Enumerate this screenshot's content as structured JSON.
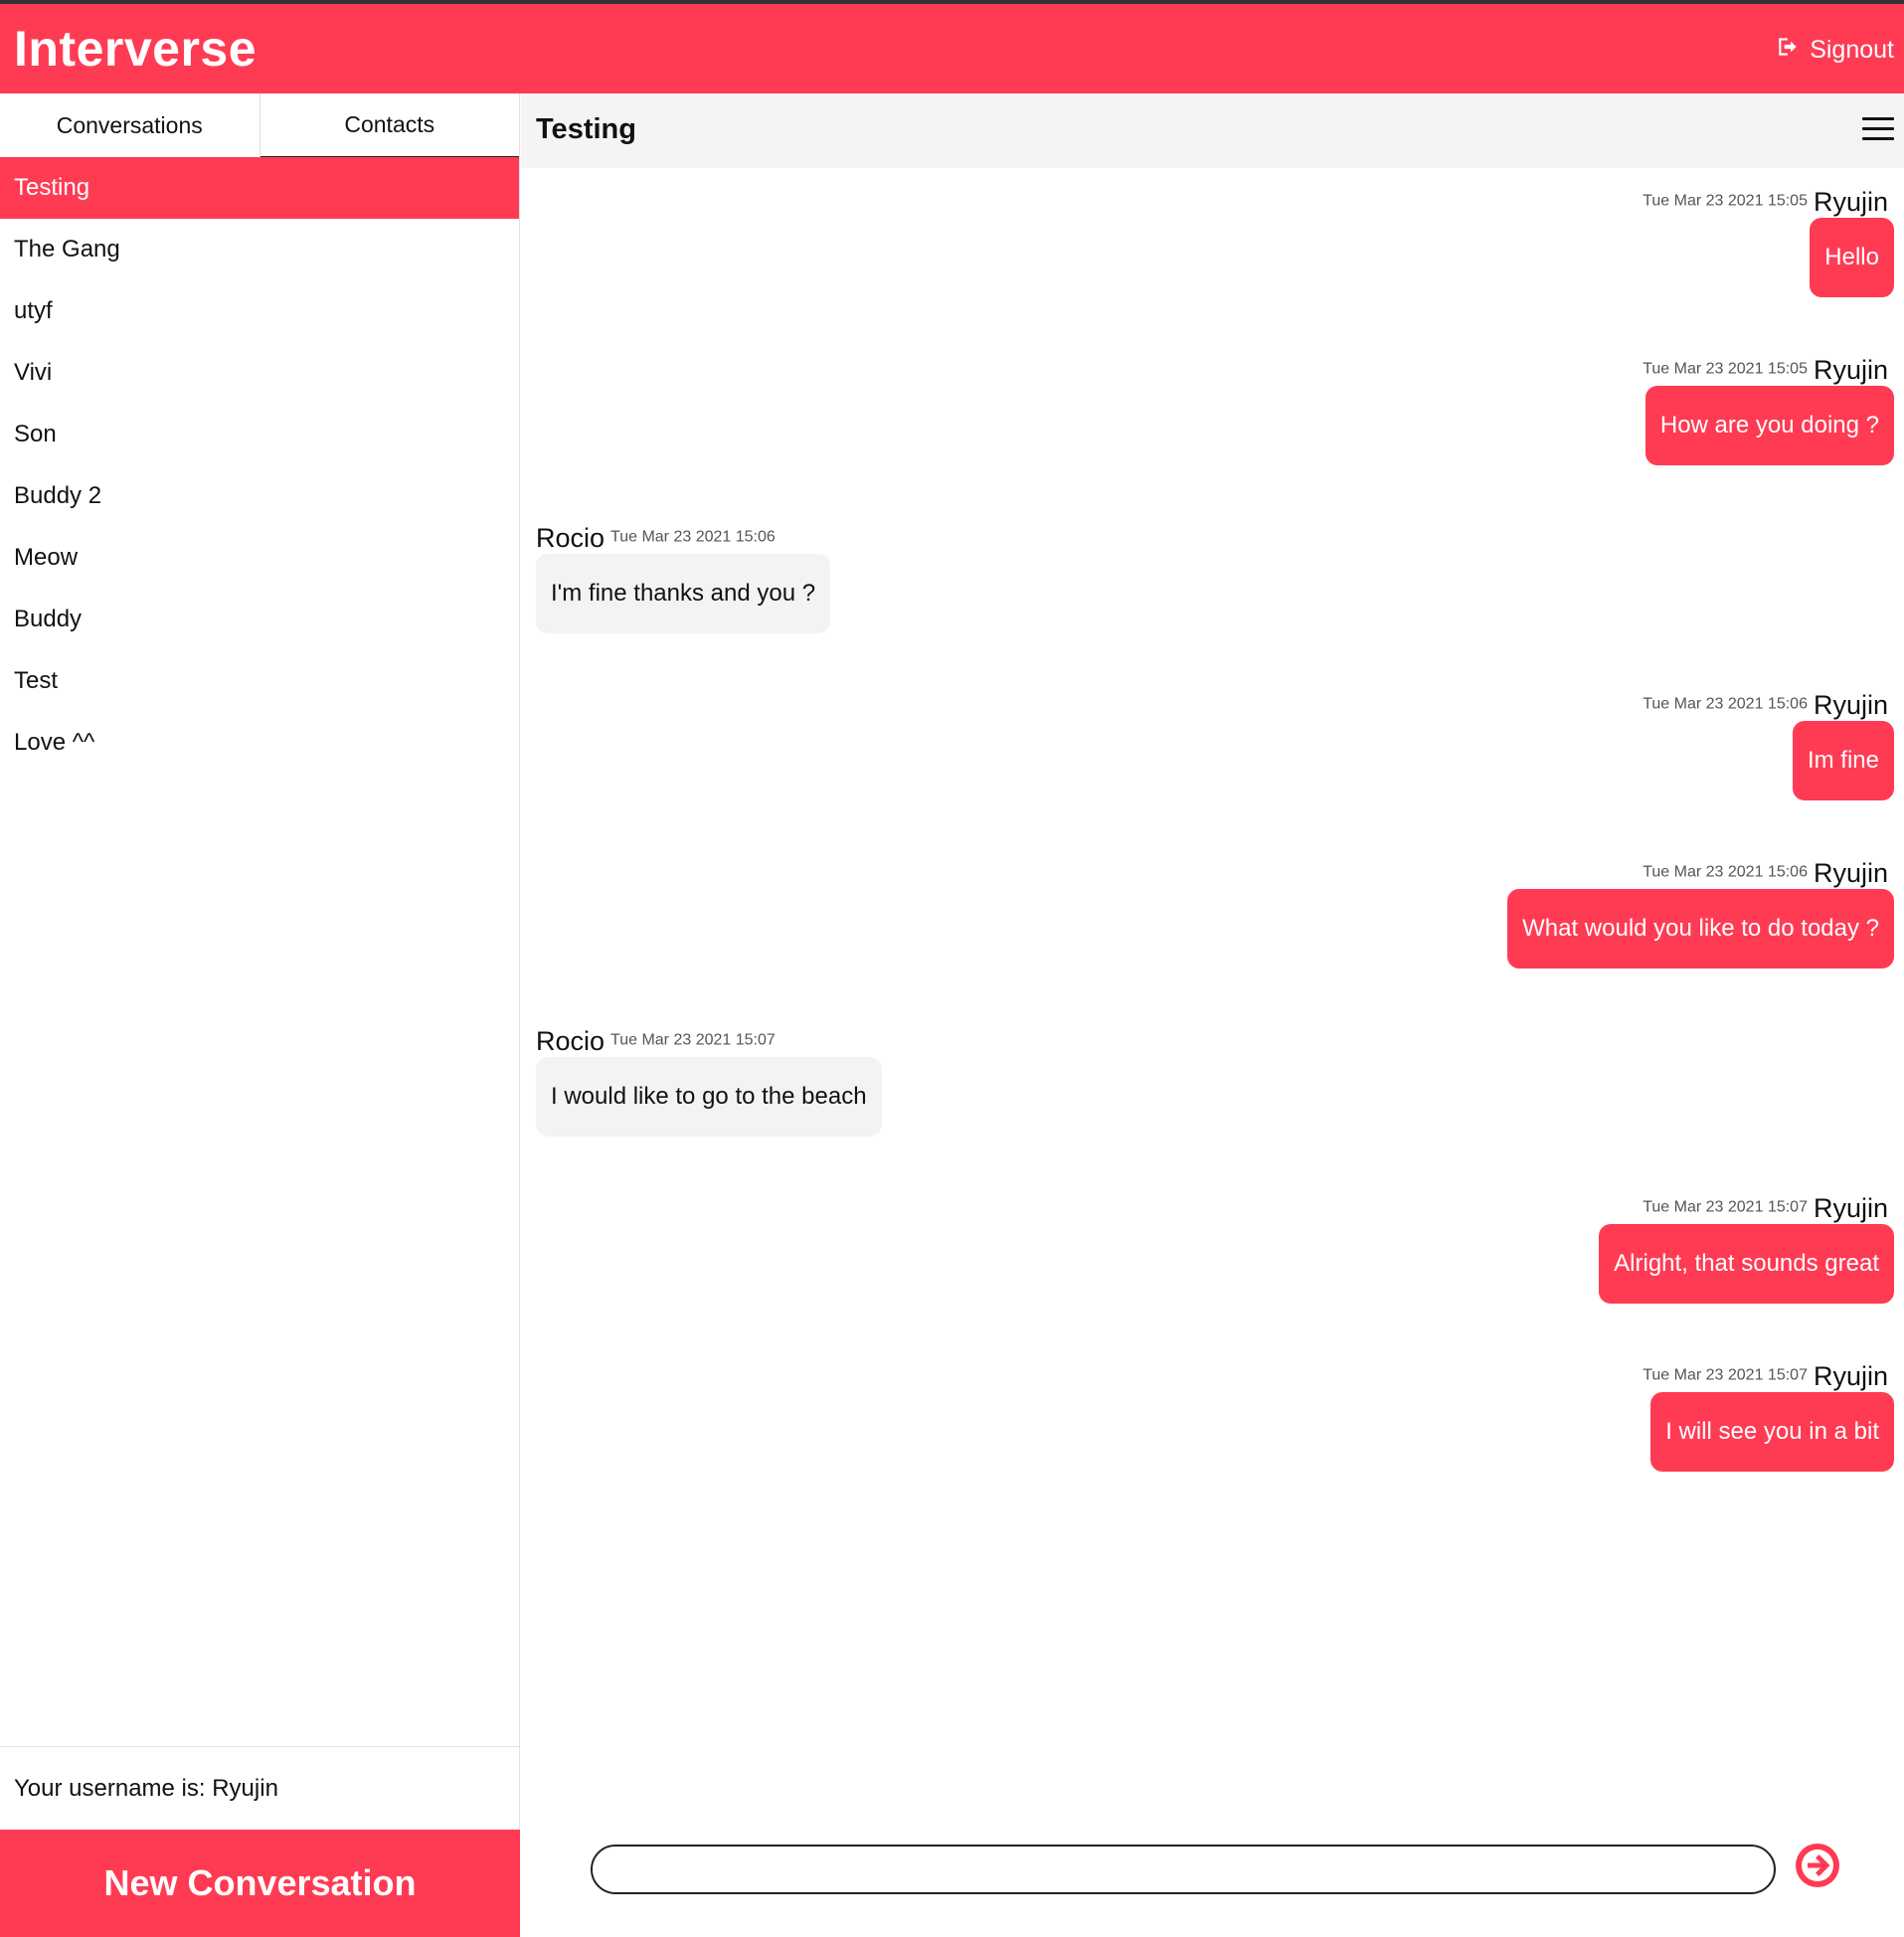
{
  "app": {
    "brand": "Interverse",
    "signout_label": "Signout",
    "accent_color": "#FF3B54"
  },
  "sidebar": {
    "tabs": [
      {
        "label": "Conversations",
        "active": true
      },
      {
        "label": "Contacts",
        "active": false
      }
    ],
    "conversations": [
      {
        "label": "Testing",
        "selected": true
      },
      {
        "label": "The Gang"
      },
      {
        "label": "utyf"
      },
      {
        "label": "Vivi"
      },
      {
        "label": "Son"
      },
      {
        "label": "Buddy 2"
      },
      {
        "label": "Meow"
      },
      {
        "label": "Buddy"
      },
      {
        "label": "Test"
      },
      {
        "label": "Love ^^"
      }
    ],
    "username_text": "Your username is: Ryujin",
    "new_conversation_label": "New Conversation"
  },
  "chat": {
    "title": "Testing",
    "messages": [
      {
        "direction": "sent",
        "sender": "Ryujin",
        "time": "Tue Mar 23 2021 15:05",
        "text": "Hello"
      },
      {
        "direction": "sent",
        "sender": "Ryujin",
        "time": "Tue Mar 23 2021 15:05",
        "text": "How are you doing ?"
      },
      {
        "direction": "received",
        "sender": "Rocio",
        "time": "Tue Mar 23 2021 15:06",
        "text": "I'm fine thanks and you ?"
      },
      {
        "direction": "sent",
        "sender": "Ryujin",
        "time": "Tue Mar 23 2021 15:06",
        "text": "Im fine"
      },
      {
        "direction": "sent",
        "sender": "Ryujin",
        "time": "Tue Mar 23 2021 15:06",
        "text": "What would you like to do today ?"
      },
      {
        "direction": "received",
        "sender": "Rocio",
        "time": "Tue Mar 23 2021 15:07",
        "text": "I would like to go to the beach"
      },
      {
        "direction": "sent",
        "sender": "Ryujin",
        "time": "Tue Mar 23 2021 15:07",
        "text": "Alright, that sounds great"
      },
      {
        "direction": "sent",
        "sender": "Ryujin",
        "time": "Tue Mar 23 2021 15:07",
        "text": "I will see you in a bit"
      }
    ],
    "composer": {
      "value": "",
      "placeholder": ""
    }
  },
  "icons": {
    "signout": "sign-out-icon",
    "menu": "hamburger-menu-icon",
    "send": "arrow-right-circle-icon"
  }
}
